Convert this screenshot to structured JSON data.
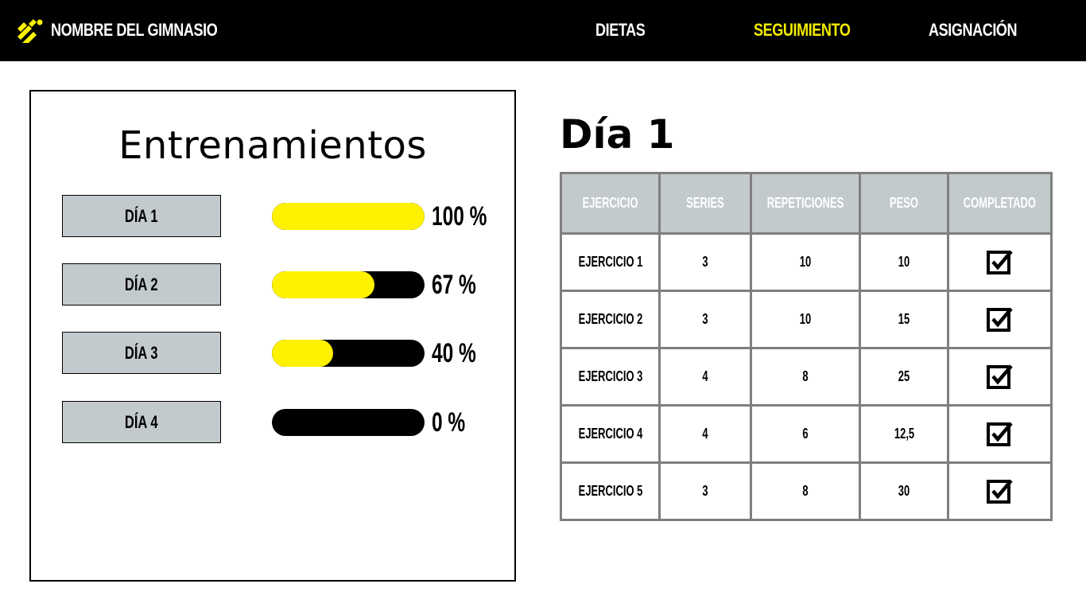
{
  "header": {
    "brand": "NOMBRE DEL GIMNASIO",
    "nav": [
      {
        "label": "DIETAS",
        "active": false
      },
      {
        "label": "SEGUIMIENTO",
        "active": true
      },
      {
        "label": "ASIGNACIÓN",
        "active": false
      }
    ]
  },
  "trainings": {
    "title": "Entrenamientos",
    "days": [
      {
        "label": "DÍA 1",
        "progress": 100,
        "progress_label": "100 %"
      },
      {
        "label": "DÍA 2",
        "progress": 67,
        "progress_label": "67 %"
      },
      {
        "label": "DÍA 3",
        "progress": 40,
        "progress_label": "40 %"
      },
      {
        "label": "DÍA 4",
        "progress": 0,
        "progress_label": "0 %"
      }
    ]
  },
  "detail": {
    "title": "Día 1",
    "columns": [
      "EJERCICIO",
      "SERIES",
      "REPETICIONES",
      "PESO",
      "COMPLETADO"
    ],
    "rows": [
      {
        "exercise": "EJERCICIO 1",
        "series": "3",
        "reps": "10",
        "weight": "10",
        "completed": true
      },
      {
        "exercise": "EJERCICIO 2",
        "series": "3",
        "reps": "10",
        "weight": "15",
        "completed": true
      },
      {
        "exercise": "EJERCICIO 3",
        "series": "4",
        "reps": "8",
        "weight": "25",
        "completed": true
      },
      {
        "exercise": "EJERCICIO 4",
        "series": "4",
        "reps": "6",
        "weight": "12,5",
        "completed": true
      },
      {
        "exercise": "EJERCICIO 5",
        "series": "3",
        "reps": "8",
        "weight": "30",
        "completed": true
      }
    ]
  },
  "colors": {
    "accent": "#fff200",
    "header_bg": "#000000",
    "cell_header_bg": "#c3cacd"
  }
}
